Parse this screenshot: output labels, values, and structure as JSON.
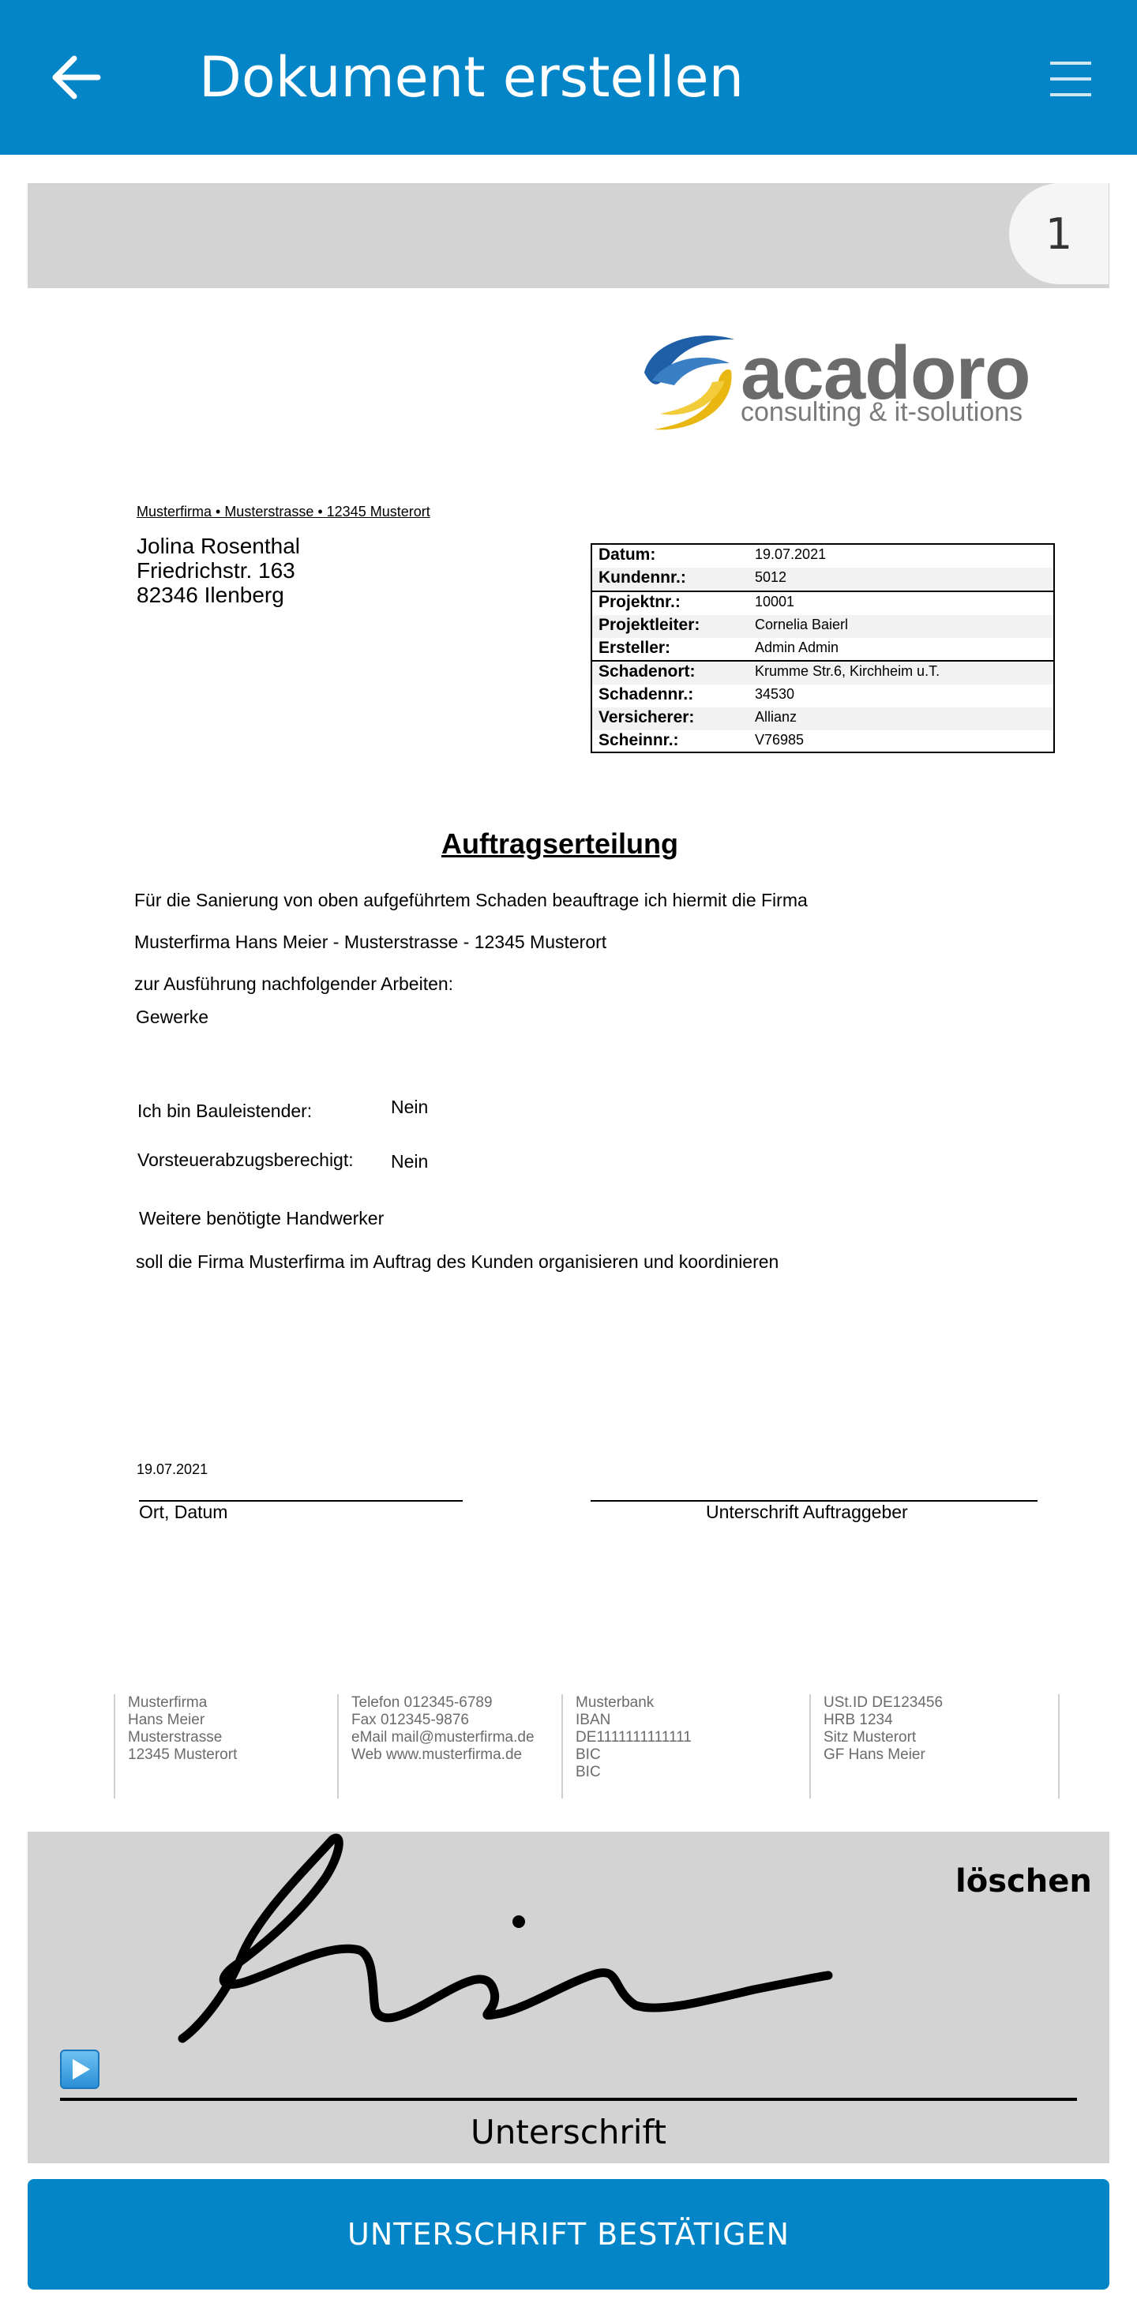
{
  "app_bar": {
    "title": "Dokument erstellen"
  },
  "page_indicator": {
    "current": "1"
  },
  "logo": {
    "word": "acadoro",
    "tagline": "consulting & it-solutions"
  },
  "sender_line": "Musterfirma • Musterstrasse • 12345 Musterort",
  "recipient": {
    "name": "Jolina Rosenthal",
    "street": "Friedrichstr. 163",
    "city": "82346 Ilenberg"
  },
  "info": [
    {
      "label": "Datum:",
      "value": "19.07.2021"
    },
    {
      "label": "Kundennr.:",
      "value": "5012"
    },
    {
      "label": "Projektnr.:",
      "value": "10001"
    },
    {
      "label": "Projektleiter:",
      "value": "Cornelia Baierl"
    },
    {
      "label": "Ersteller:",
      "value": "Admin Admin"
    },
    {
      "label": "Schadenort:",
      "value": "Krumme Str.6, Kirchheim u.T."
    },
    {
      "label": "Schadennr.:",
      "value": "34530"
    },
    {
      "label": "Versicherer:",
      "value": "Allianz"
    },
    {
      "label": "Scheinnr.:",
      "value": "V76985"
    }
  ],
  "document": {
    "heading": "Auftragserteilung",
    "line1": "Für die Sanierung von oben aufgeführtem Schaden beauftrage ich hiermit die Firma",
    "line2": "Musterfirma Hans Meier - Musterstrasse - 12345 Musterort",
    "line3": "zur Ausführung nachfolgender Arbeiten:",
    "gewerke": "Gewerke",
    "bauleistender_label": "Ich bin Bauleistender:",
    "bauleistender_value": "Nein",
    "vorsteuer_label": "Vorsteuerabzugsberechigt:",
    "vorsteuer_value": "Nein",
    "handwerker": "Weitere benötigte Handwerker",
    "organisieren": "soll die Firma Musterfirma im Auftrag des Kunden organisieren und koordinieren",
    "date": "19.07.2021",
    "ort_datum": "Ort, Datum",
    "unterschrift_auftraggeber": "Unterschrift Auftraggeber"
  },
  "footer": {
    "col1": [
      "Musterfirma",
      "Hans Meier",
      "Musterstrasse",
      "12345 Musterort"
    ],
    "col2": [
      "Telefon 012345-6789",
      "Fax 012345-9876",
      "eMail mail@musterfirma.de",
      "Web www.musterfirma.de"
    ],
    "col3": [
      "Musterbank",
      "IBAN",
      "DE1111111111111",
      "BIC",
      "BIC"
    ],
    "col4": [
      "USt.ID DE123456",
      "HRB 1234",
      "Sitz  Musterort",
      "GF  Hans Meier"
    ]
  },
  "signature": {
    "clear_label": "löschen",
    "caption": "Unterschrift"
  },
  "confirm_button": "UNTERSCHRIFT BESTÄTIGEN",
  "colors": {
    "primary": "#0385c7",
    "panel": "#d3d3d3"
  }
}
